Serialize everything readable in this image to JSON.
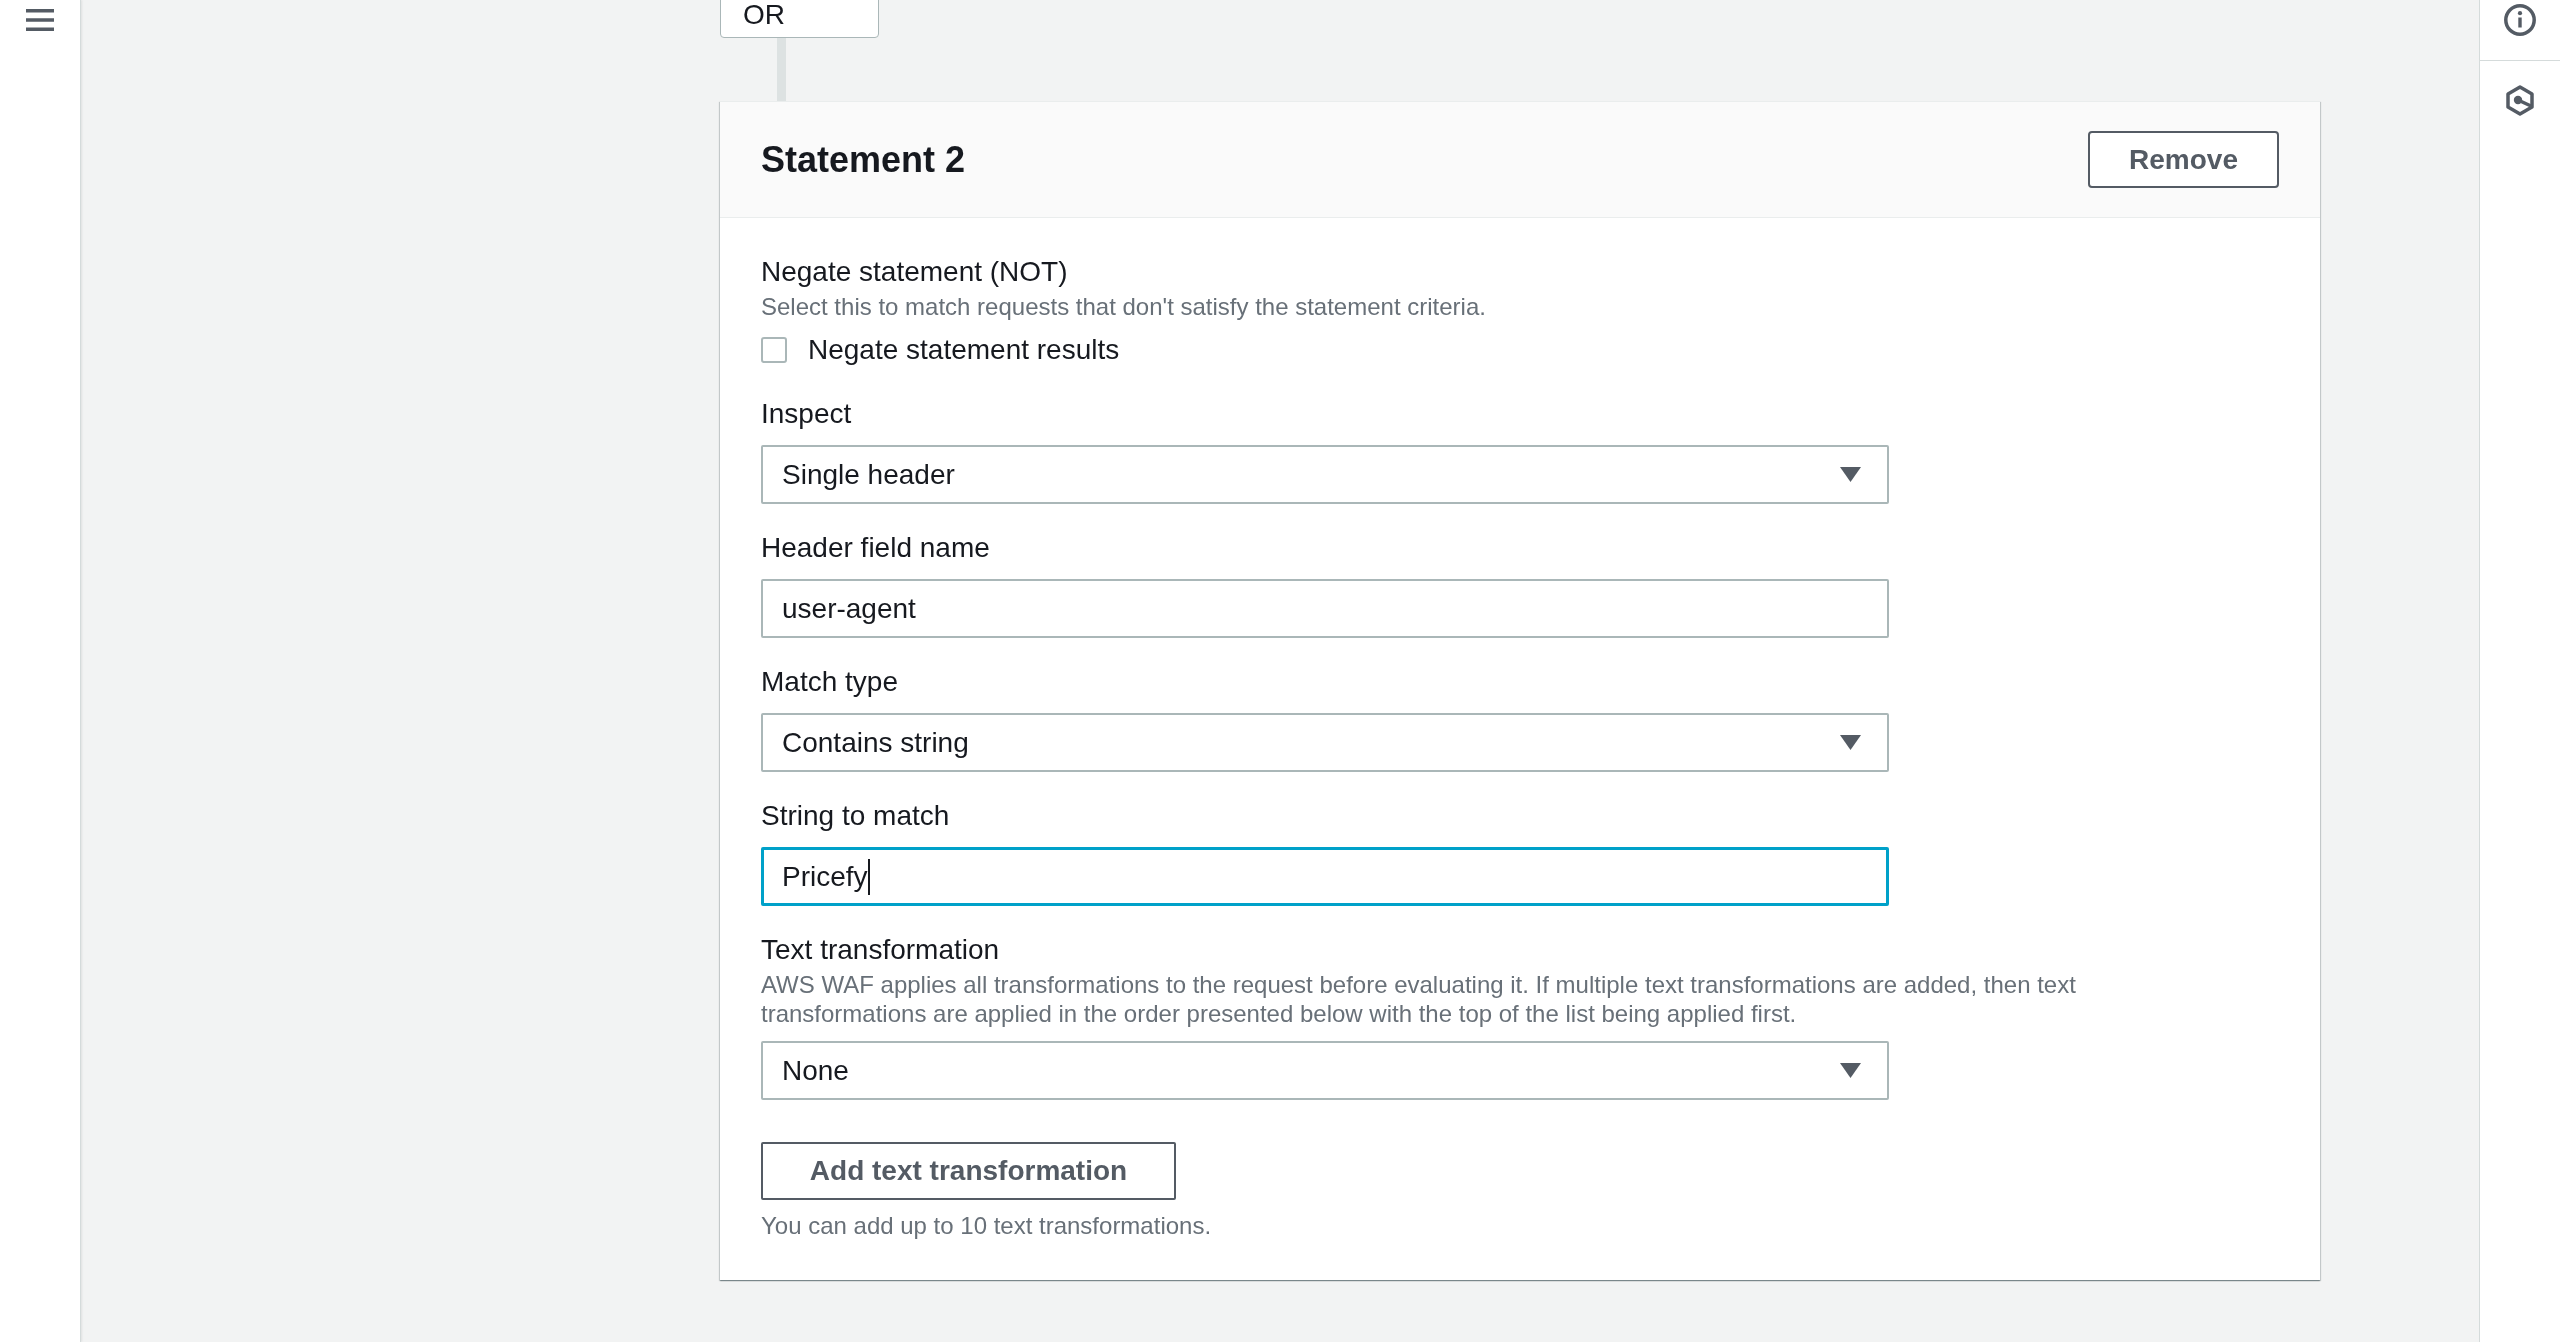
{
  "operator": {
    "label": "OR"
  },
  "statement": {
    "title": "Statement 2",
    "remove_button": "Remove",
    "negate": {
      "label": "Negate statement (NOT)",
      "description": "Select this to match requests that don't satisfy the statement criteria.",
      "checkbox": {
        "label": "Negate statement results",
        "checked": false
      }
    },
    "fields": [
      {
        "kind": "select",
        "label": "Inspect",
        "value": "Single header"
      },
      {
        "kind": "text",
        "label": "Header field name",
        "value": "user-agent",
        "focused": false
      },
      {
        "kind": "select",
        "label": "Match type",
        "value": "Contains string"
      },
      {
        "kind": "text",
        "label": "String to match",
        "value": "Pricefy",
        "focused": true
      },
      {
        "kind": "select",
        "label": "Text transformation",
        "description": "AWS WAF applies all transformations to the request before evaluating it. If multiple text transformations are added, then text transformations are applied in the order presented below with the top of the list being applied first.",
        "value": "None"
      }
    ],
    "add_button": "Add text transformation",
    "add_hint": "You can add up to 10 text transformations."
  }
}
